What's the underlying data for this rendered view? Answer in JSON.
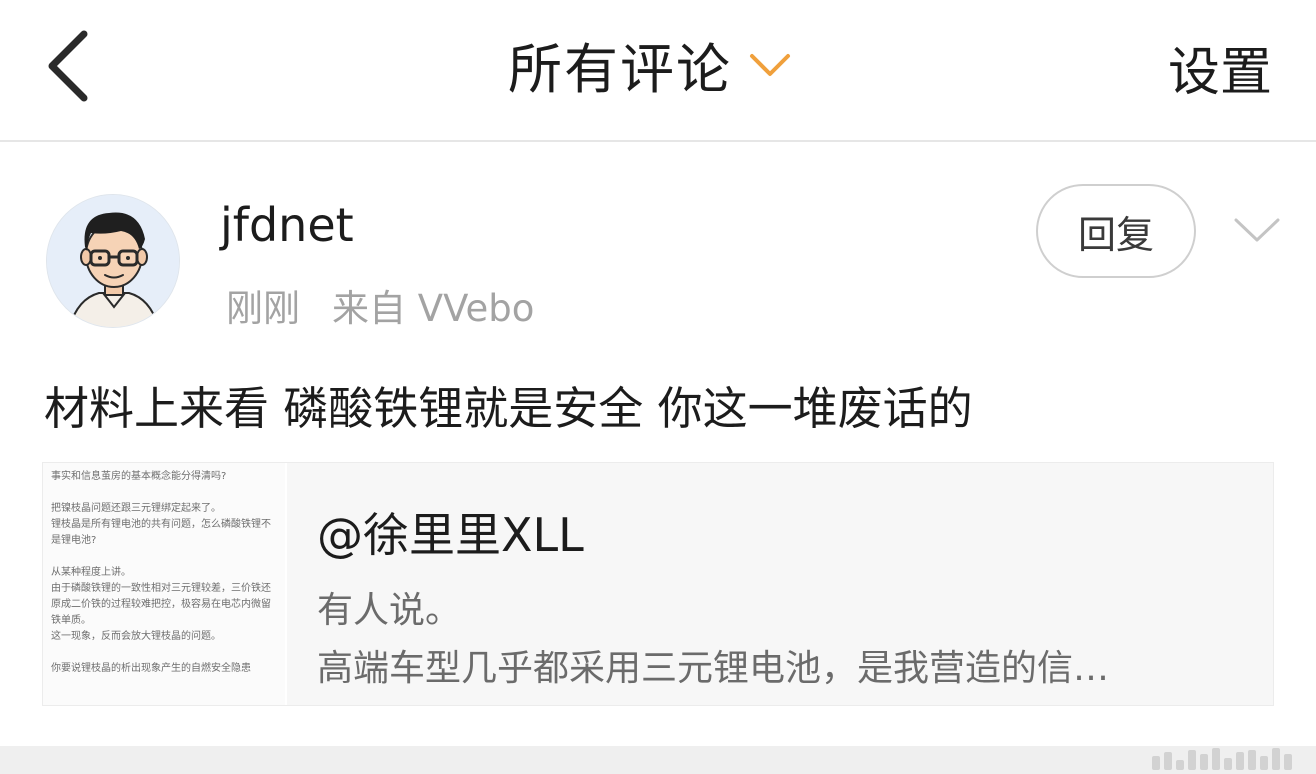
{
  "nav": {
    "title": "所有评论",
    "settings_label": "设置",
    "accent_color": "#f0a03c"
  },
  "comment": {
    "username": "jfdnet",
    "time": "刚刚",
    "source": "来自 VVebo",
    "reply_label": "回复",
    "text": "材料上来看 磷酸铁锂就是安全 你这一堆废话的",
    "quote": {
      "author": "@徐里里XLL",
      "line1": "有人说。",
      "line2": "高端车型几乎都采用三元锂电池，是我营造的信…",
      "thumbnail_lines": [
        "事实和信息茧房的基本概念能分得清吗?",
        "",
        "把镍枝晶问题还跟三元锂绑定起来了。",
        "锂枝晶是所有锂电池的共有问题，怎么磷酸铁锂不",
        "是锂电池?",
        "",
        "从某种程度上讲。",
        "由于磷酸铁锂的一致性相对三元锂较差，三价铁还",
        "原成二价铁的过程较难把控，极容易在电芯内微留",
        "铁单质。",
        "这一现象，反而会放大锂枝晶的问题。",
        "",
        "你要说锂枝晶的析出现象产生的自燃安全隐患"
      ]
    }
  },
  "icons": {
    "back": "chevron-left-icon",
    "title_dropdown": "chevron-down-icon",
    "more": "chevron-down-icon"
  }
}
